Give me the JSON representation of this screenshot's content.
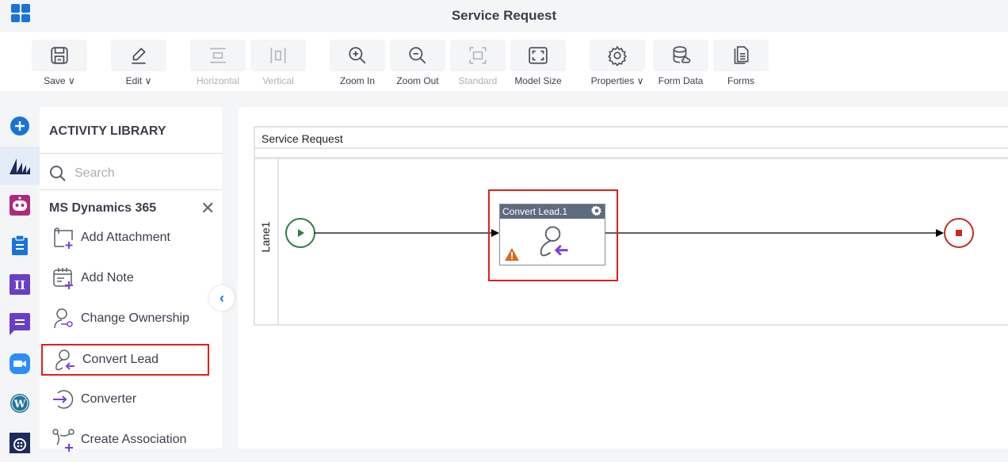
{
  "header": {
    "title": "Service Request",
    "apps_icon": "app-grid-icon"
  },
  "toolbar": {
    "buttons": [
      {
        "label": "Save",
        "icon": "save-icon",
        "dropdown": true,
        "enabled": true
      },
      {
        "label": "Edit",
        "icon": "pencil-icon",
        "dropdown": true,
        "enabled": true
      },
      {
        "label": "Horizontal",
        "icon": "horizontal-layout-icon",
        "dropdown": false,
        "enabled": false
      },
      {
        "label": "Vertical",
        "icon": "vertical-layout-icon",
        "dropdown": false,
        "enabled": false
      },
      {
        "label": "Zoom In",
        "icon": "zoom-in-icon",
        "dropdown": false,
        "enabled": true
      },
      {
        "label": "Zoom Out",
        "icon": "zoom-out-icon",
        "dropdown": false,
        "enabled": true
      },
      {
        "label": "Standard",
        "icon": "standard-size-icon",
        "dropdown": false,
        "enabled": false
      },
      {
        "label": "Model Size",
        "icon": "fit-model-icon",
        "dropdown": false,
        "enabled": true
      },
      {
        "label": "Properties",
        "icon": "gear-icon",
        "dropdown": true,
        "enabled": true
      },
      {
        "label": "Form Data",
        "icon": "database-icon",
        "dropdown": false,
        "enabled": true
      },
      {
        "label": "Forms",
        "icon": "forms-icon",
        "dropdown": false,
        "enabled": true
      }
    ]
  },
  "rail": {
    "items": [
      {
        "name": "add",
        "icon": "plus-circle-icon",
        "active": false
      },
      {
        "name": "ms-dynamics",
        "icon": "dynamics-icon",
        "active": true
      },
      {
        "name": "bot",
        "icon": "bot-icon",
        "active": false
      },
      {
        "name": "clipboard",
        "icon": "clipboard-icon",
        "active": false
      },
      {
        "name": "text-tool",
        "icon": "text-tool-icon",
        "active": false
      },
      {
        "name": "chat",
        "icon": "chat-icon",
        "active": false
      },
      {
        "name": "zoom",
        "icon": "video-icon",
        "active": false
      },
      {
        "name": "wordpress",
        "icon": "wordpress-icon",
        "active": false
      },
      {
        "name": "twilio",
        "icon": "twilio-icon",
        "active": false
      }
    ]
  },
  "library": {
    "title": "ACTIVITY LIBRARY",
    "search_placeholder": "Search",
    "category": "MS Dynamics 365",
    "items": [
      {
        "label": "Add Attachment",
        "icon": "add-attachment-icon",
        "selected": false
      },
      {
        "label": "Add Note",
        "icon": "add-note-icon",
        "selected": false
      },
      {
        "label": "Change Ownership",
        "icon": "change-ownership-icon",
        "selected": false
      },
      {
        "label": "Convert Lead",
        "icon": "convert-lead-icon",
        "selected": true
      },
      {
        "label": "Converter",
        "icon": "converter-icon",
        "selected": false
      },
      {
        "label": "Create Association",
        "icon": "create-association-icon",
        "selected": false
      }
    ]
  },
  "canvas": {
    "pool_name": "Service Request",
    "lane_name": "Lane1",
    "task": {
      "label": "Convert Lead.1",
      "warning": true
    },
    "colors": {
      "start": "#2e7d46",
      "end": "#c62828",
      "highlight": "#e01e1e",
      "task_header": "#5f6b82"
    }
  }
}
